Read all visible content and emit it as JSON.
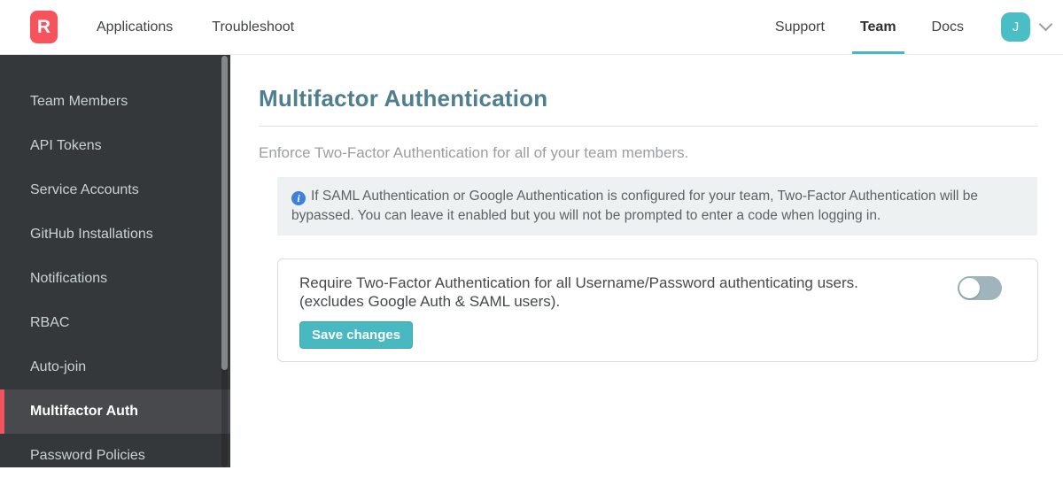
{
  "header": {
    "logo_letter": "R",
    "nav_left": [
      {
        "label": "Applications"
      },
      {
        "label": "Troubleshoot"
      }
    ],
    "nav_right": [
      {
        "label": "Support",
        "active": false
      },
      {
        "label": "Team",
        "active": true
      },
      {
        "label": "Docs",
        "active": false
      }
    ],
    "avatar_initial": "J"
  },
  "sidebar": {
    "items": [
      {
        "label": "Team Members",
        "active": false
      },
      {
        "label": "API Tokens",
        "active": false
      },
      {
        "label": "Service Accounts",
        "active": false
      },
      {
        "label": "GitHub Installations",
        "active": false
      },
      {
        "label": "Notifications",
        "active": false
      },
      {
        "label": "RBAC",
        "active": false
      },
      {
        "label": "Auto-join",
        "active": false
      },
      {
        "label": "Multifactor Auth",
        "active": true
      },
      {
        "label": "Password Policies",
        "active": false
      }
    ]
  },
  "main": {
    "title": "Multifactor Authentication",
    "subtitle": "Enforce Two-Factor Authentication for all of your team members.",
    "info_icon_glyph": "i",
    "info_note": "If SAML Authentication or Google Authentication is configured for your team, Two-Factor Authentication will be bypassed. You can leave it enabled but you will not be prompted to enter a code when logging in.",
    "setting": {
      "label_line1": "Require Two-Factor Authentication for all Username/Password authenticating users.",
      "label_line2": "(excludes Google Auth & SAML users).",
      "toggle_state": "off",
      "save_button_label": "Save changes"
    }
  },
  "colors": {
    "brand_red": "#f8535c",
    "accent_teal": "#48b9c0",
    "heading_teal": "#4f7e8e",
    "sidebar_bg": "#35383a",
    "sidebar_active_bg": "#47494c",
    "sidebar_active_border": "#f4525e",
    "info_icon_blue": "#3f80db",
    "toggle_off": "#9fb5bb"
  }
}
